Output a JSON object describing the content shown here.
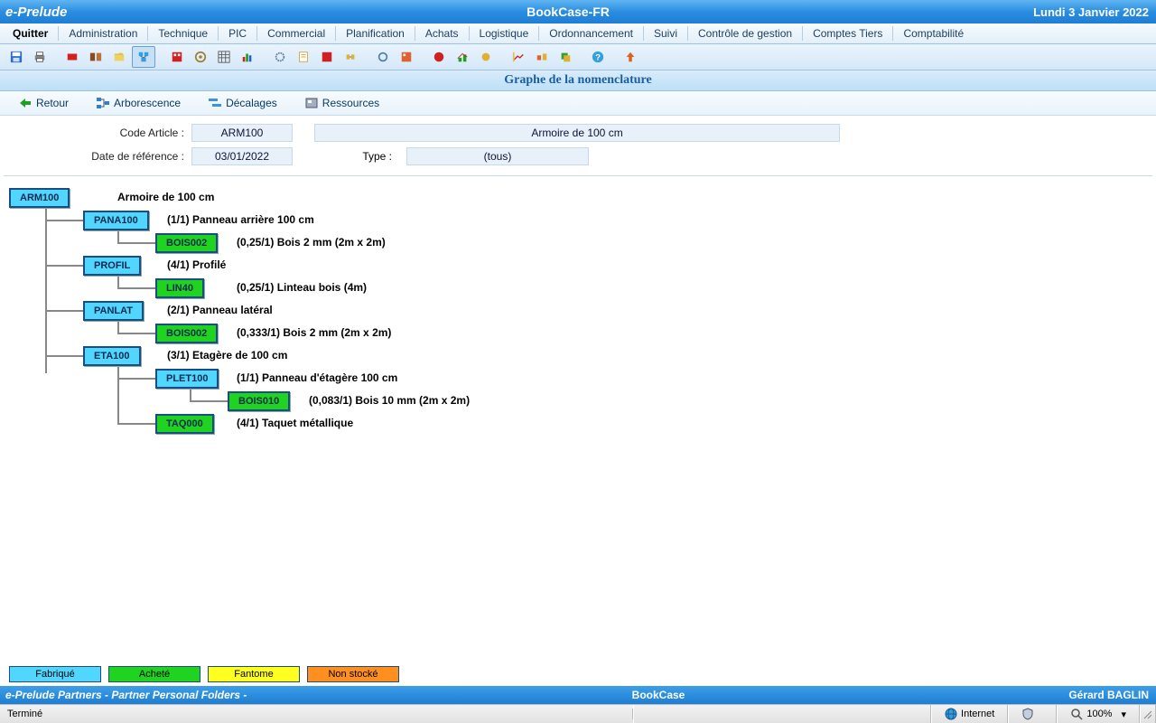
{
  "header": {
    "app": "e-Prelude",
    "project": "BookCase-FR",
    "date": "Lundi 3 Janvier 2022"
  },
  "menu": [
    "Quitter",
    "Administration",
    "Technique",
    "PIC",
    "Commercial",
    "Planification",
    "Achats",
    "Logistique",
    "Ordonnancement",
    "Suivi",
    "Contrôle de gestion",
    "Comptes Tiers",
    "Comptabilité"
  ],
  "page_title": "Graphe de la nomenclature",
  "subbar": {
    "retour": "Retour",
    "arbo": "Arborescence",
    "decal": "Décalages",
    "ress": "Ressources"
  },
  "form": {
    "code_label": "Code Article :",
    "code": "ARM100",
    "desc": "Armoire de 100 cm",
    "dateref_label": "Date de référence :",
    "dateref": "03/01/2022",
    "type_label": "Type :",
    "type": "(tous)"
  },
  "nodes": {
    "arm100": {
      "code": "ARM100",
      "label": "Armoire de 100 cm"
    },
    "pana100": {
      "code": "PANA100",
      "label": "(1/1) Panneau arrière 100 cm"
    },
    "bois002a": {
      "code": "BOIS002",
      "label": "(0,25/1) Bois 2 mm (2m x 2m)"
    },
    "profil": {
      "code": "PROFIL",
      "label": "(4/1) Profilé"
    },
    "lin40": {
      "code": "LIN40",
      "label": "(0,25/1) Linteau bois (4m)"
    },
    "panlat": {
      "code": "PANLAT",
      "label": "(2/1) Panneau latéral"
    },
    "bois002b": {
      "code": "BOIS002",
      "label": "(0,333/1) Bois 2 mm (2m x 2m)"
    },
    "eta100": {
      "code": "ETA100",
      "label": "(3/1) Etagère de 100 cm"
    },
    "plet100": {
      "code": "PLET100",
      "label": "(1/1) Panneau d'étagère 100 cm"
    },
    "bois010": {
      "code": "BOIS010",
      "label": "(0,083/1) Bois 10 mm (2m x 2m)"
    },
    "taq000": {
      "code": "TAQ000",
      "label": "(4/1) Taquet métallique"
    }
  },
  "legend": [
    "Fabriqué",
    "Acheté",
    "Fantome",
    "Non stocké"
  ],
  "footer": {
    "left": "e-Prelude Partners - Partner Personal Folders -",
    "center": "BookCase",
    "right": "Gérard BAGLIN"
  },
  "status": {
    "msg": "Terminé",
    "net": "Internet",
    "zoom": "100%"
  }
}
